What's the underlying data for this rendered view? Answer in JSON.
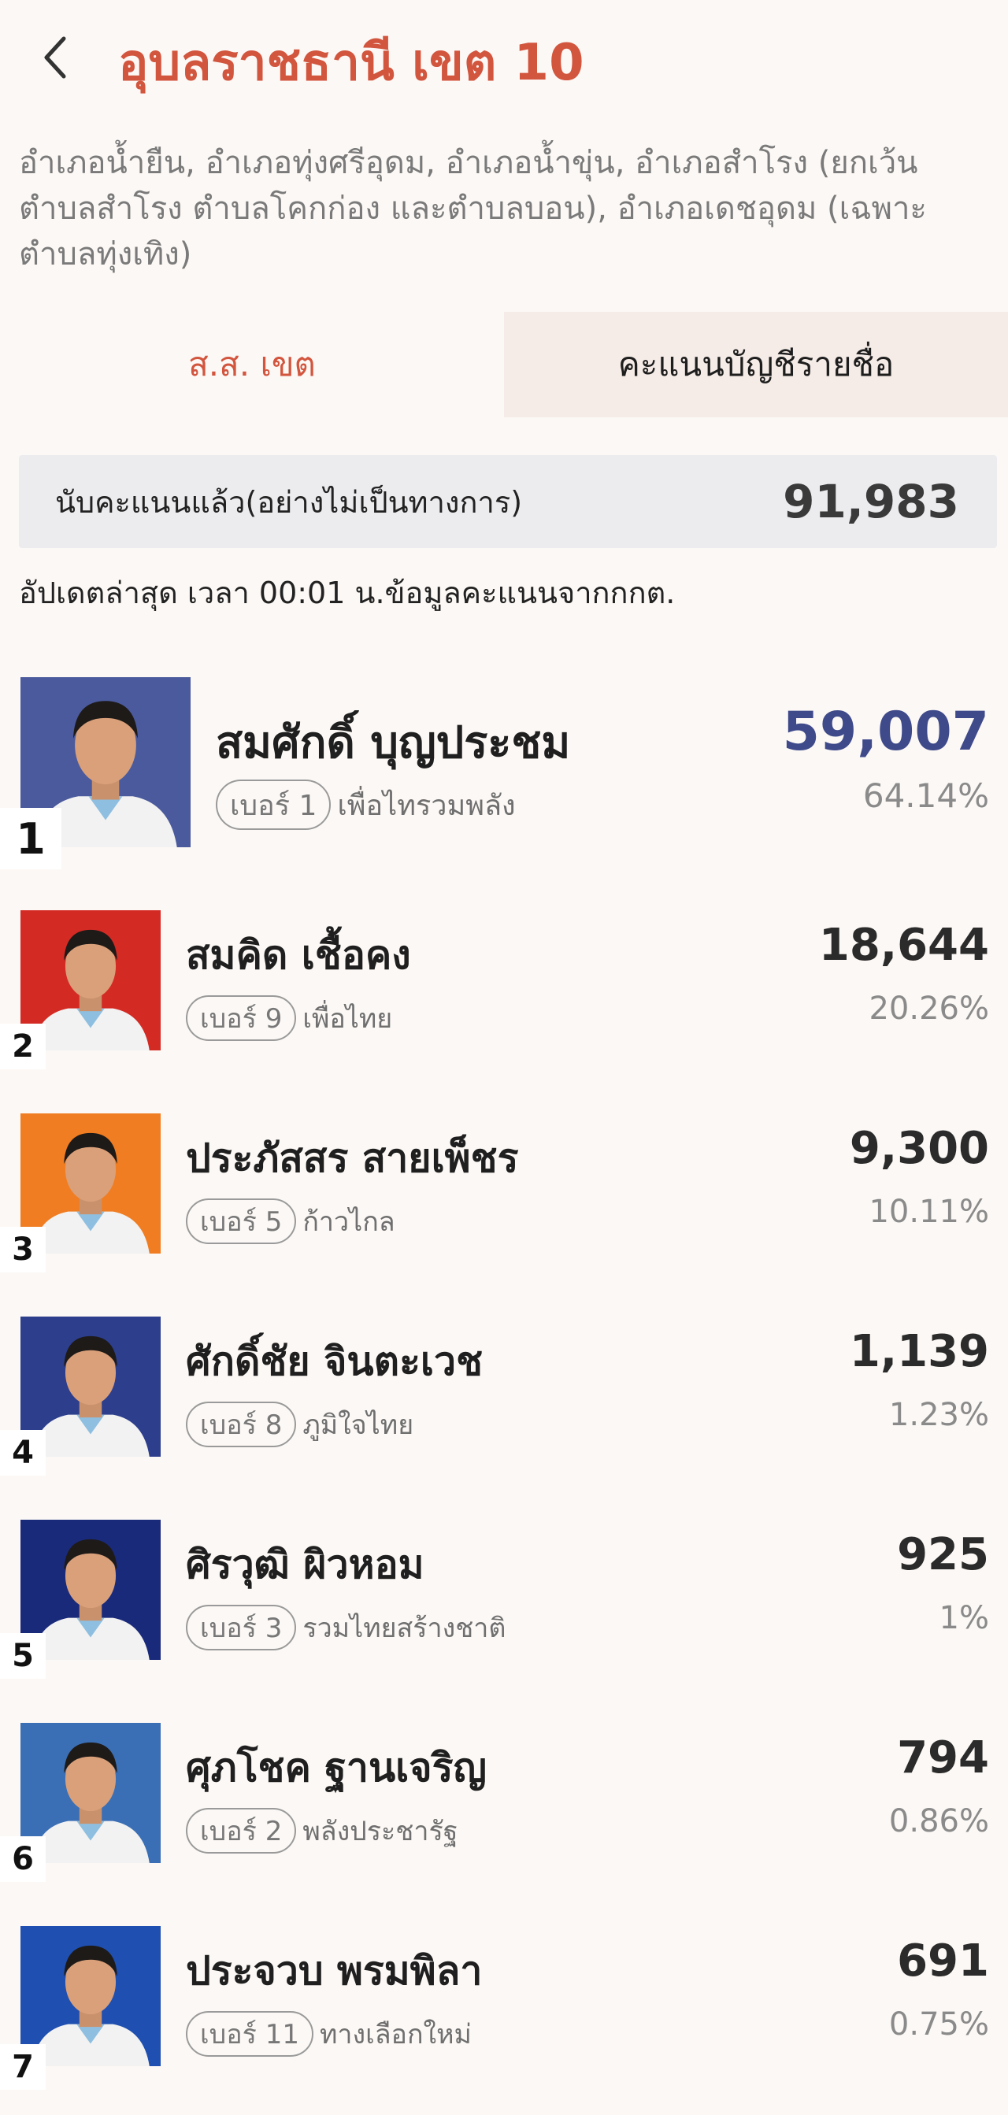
{
  "header": {
    "back_icon": "chevron-left-icon",
    "title": "อุบลราชธานี เขต 10"
  },
  "district_description": "อำเภอน้ำยืน, อำเภอทุ่งศรีอุดม, อำเภอน้ำขุ่น, อำเภอสำโรง (ยกเว้นตำบลสำโรง ตำบลโคกก่อง และตำบลบอน), อำเภอเดชอุดม (เฉพาะตำบลทุ่งเทิง)",
  "tabs": [
    {
      "label": "ส.ส. เขต",
      "active": true
    },
    {
      "label": "คะแนนบัญชีรายชื่อ",
      "active": false
    }
  ],
  "counted": {
    "label": "นับคะแนนแล้ว(อย่างไม่เป็นทางการ)",
    "value": "91,983"
  },
  "update_text": "อัปเดตล่าสุด เวลา 00:01 น.ข้อมูลคะแนนจากกกต.",
  "candidates": [
    {
      "rank": "1",
      "name": "สมศักดิ์ บุญประชม",
      "number_label": "เบอร์ 1",
      "party": "เพื่อไทรวมพลัง",
      "votes": "59,007",
      "percent": "64.14%",
      "votes_color": "#3f4a8a",
      "photo_bg": "#4a5a9c"
    },
    {
      "rank": "2",
      "name": "สมคิด เชื้อคง",
      "number_label": "เบอร์ 9",
      "party": "เพื่อไทย",
      "votes": "18,644",
      "percent": "20.26%",
      "votes_color": "#2b2b2b",
      "photo_bg": "#d42a24"
    },
    {
      "rank": "3",
      "name": "ประภัสสร สายเพ็ชร",
      "number_label": "เบอร์ 5",
      "party": "ก้าวไกล",
      "votes": "9,300",
      "percent": "10.11%",
      "votes_color": "#2b2b2b",
      "photo_bg": "#f07d22"
    },
    {
      "rank": "4",
      "name": "ศักดิ์ชัย จินตะเวช",
      "number_label": "เบอร์ 8",
      "party": "ภูมิใจไทย",
      "votes": "1,139",
      "percent": "1.23%",
      "votes_color": "#2b2b2b",
      "photo_bg": "#2c3e8c"
    },
    {
      "rank": "5",
      "name": "ศิรวุฒิ ผิวหอม",
      "number_label": "เบอร์ 3",
      "party": "รวมไทยสร้างชาติ",
      "votes": "925",
      "percent": "1%",
      "votes_color": "#2b2b2b",
      "photo_bg": "#1a2a7a"
    },
    {
      "rank": "6",
      "name": "ศุภโชค ฐานเจริญ",
      "number_label": "เบอร์ 2",
      "party": "พลังประชารัฐ",
      "votes": "794",
      "percent": "0.86%",
      "votes_color": "#2b2b2b",
      "photo_bg": "#3b6fb5"
    },
    {
      "rank": "7",
      "name": "ประจวบ พรมพิลา",
      "number_label": "เบอร์ 11",
      "party": "ทางเลือกใหม่",
      "votes": "691",
      "percent": "0.75%",
      "votes_color": "#2b2b2b",
      "photo_bg": "#1f4fb0"
    }
  ]
}
